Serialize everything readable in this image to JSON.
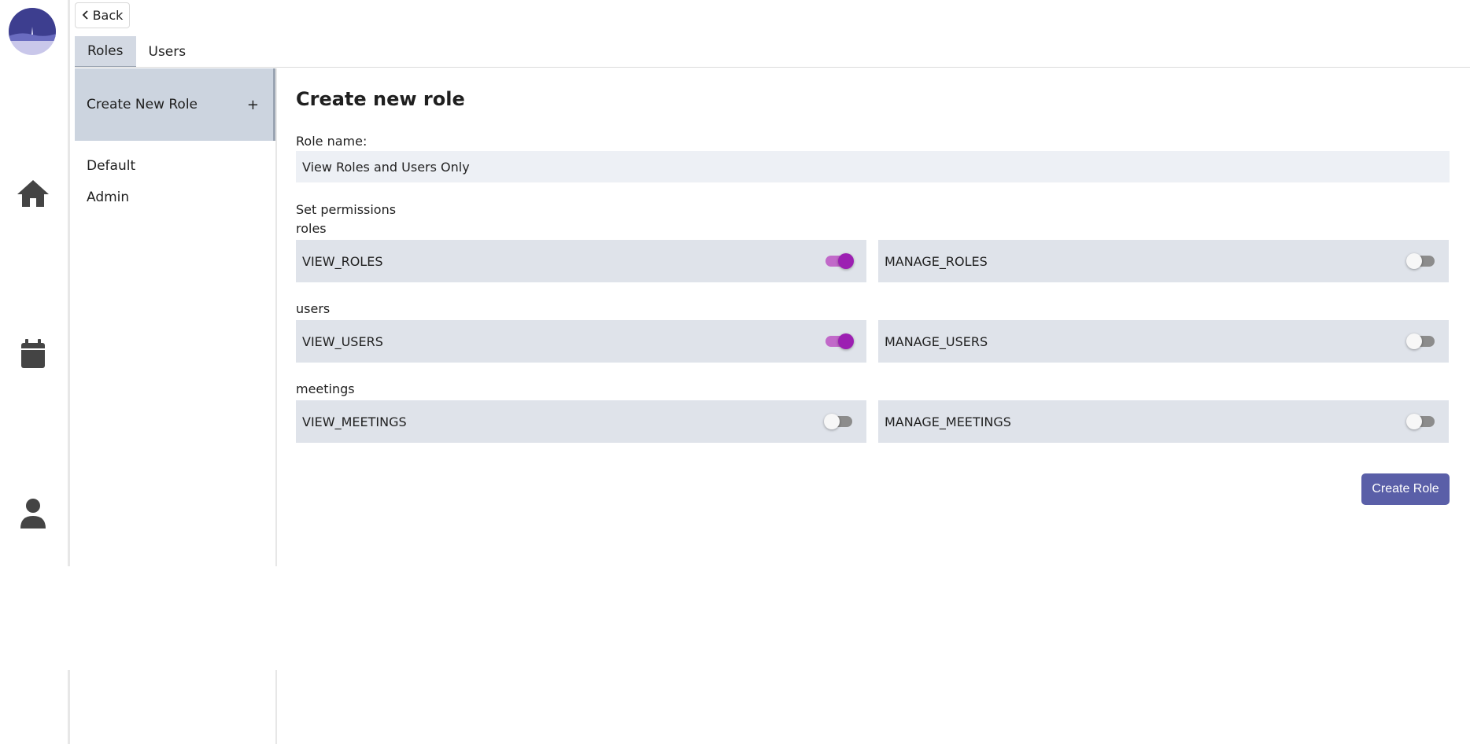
{
  "nav": {
    "back_label": "Back",
    "icons": [
      "logo",
      "home-icon",
      "calendar-icon",
      "person-icon"
    ]
  },
  "tabs": [
    {
      "label": "Roles",
      "active": true
    },
    {
      "label": "Users",
      "active": false
    }
  ],
  "roles_panel": {
    "create_label": "Create New Role",
    "create_symbol": "+",
    "items": [
      "Default",
      "Admin"
    ]
  },
  "form": {
    "title": "Create new role",
    "role_name_label": "Role name:",
    "role_name_value": "View Roles and Users Only",
    "permissions_label": "Set permissions",
    "groups": [
      {
        "label": "roles",
        "permissions": [
          {
            "name": "VIEW_ROLES",
            "enabled": true
          },
          {
            "name": "MANAGE_ROLES",
            "enabled": false
          }
        ]
      },
      {
        "label": "users",
        "permissions": [
          {
            "name": "VIEW_USERS",
            "enabled": true
          },
          {
            "name": "MANAGE_USERS",
            "enabled": false
          }
        ]
      },
      {
        "label": "meetings",
        "permissions": [
          {
            "name": "VIEW_MEETINGS",
            "enabled": false
          },
          {
            "name": "MANAGE_MEETINGS",
            "enabled": false
          }
        ]
      }
    ],
    "submit_label": "Create Role"
  },
  "colors": {
    "accent": "#5a5fa8",
    "toggle_on_thumb": "#9c1fb2",
    "toggle_on_track": "#c169c9",
    "selected_bg": "#ccd4df",
    "card_bg": "#dfe3ea"
  }
}
